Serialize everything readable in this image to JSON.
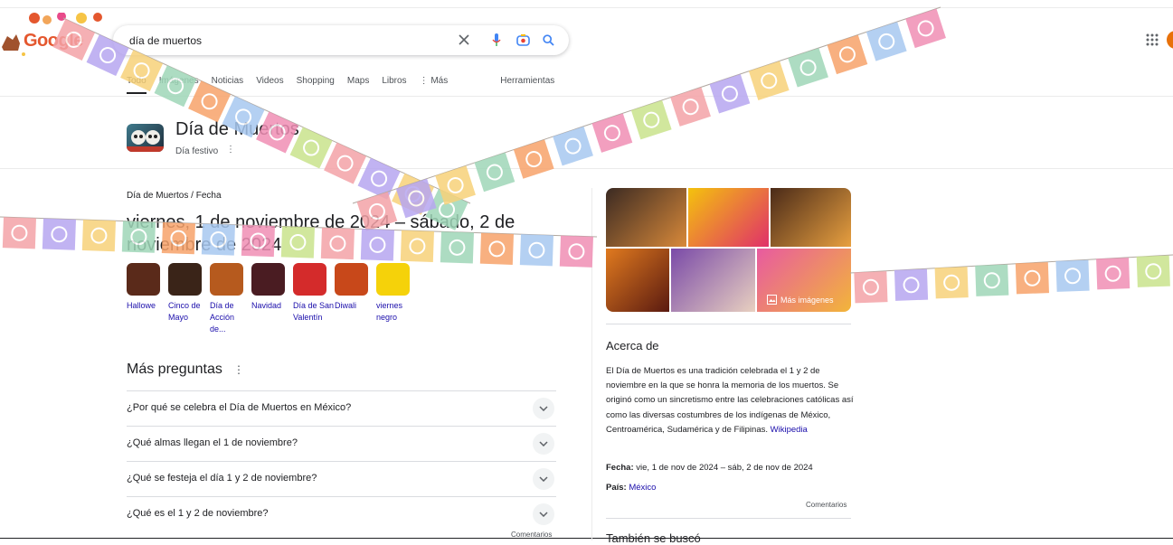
{
  "logo": {
    "text": "Google"
  },
  "search": {
    "value": "día de muertos"
  },
  "tabs": [
    {
      "label": "Todo"
    },
    {
      "label": "Imágenes"
    },
    {
      "label": "Noticias"
    },
    {
      "label": "Videos"
    },
    {
      "label": "Shopping"
    },
    {
      "label": "Maps"
    },
    {
      "label": "Libros"
    },
    {
      "label": "⋮ Más"
    },
    {
      "label": "Herramientas"
    }
  ],
  "entity": {
    "title": "Día de Muertos",
    "subtitle": "Día festivo"
  },
  "answer": {
    "breadcrumb_1": "Día de Muertos",
    "breadcrumb_sep": "/",
    "breadcrumb_2": "Fecha",
    "text": "viernes, 1 de noviembre de 2024 – sábado, 2 de noviembre de 2024"
  },
  "holidays": [
    {
      "label": "Hallowe",
      "color": "#5a2a1a"
    },
    {
      "label": "Cinco de Mayo",
      "color": "#3a2418"
    },
    {
      "label": "Día de Acción de...",
      "color": "#b65a1e"
    },
    {
      "label": "Navidad",
      "color": "#4a1c22"
    },
    {
      "label": "Día de San Valentín",
      "color": "#d42b2b"
    },
    {
      "label": "Diwali",
      "color": "#c8481a"
    },
    {
      "label": "viernes negro",
      "color": "#f5d20a"
    }
  ],
  "paa": {
    "title": "Más preguntas",
    "questions": [
      "¿Por qué se celebra el Día de Muertos en México?",
      "¿Qué almas llegan el 1 de noviembre?",
      "¿Qué se festeja el día 1 y 2 de noviembre?",
      "¿Qué es el 1 y 2 de noviembre?"
    ],
    "feedback": "Comentarios"
  },
  "panel": {
    "more_images": "Más imágenes",
    "about_title": "Acerca de",
    "description": "El Día de Muertos es una tradición celebrada el 1 y 2 de noviembre en la que se honra la memoria de los muertos. Se originó como un sincretismo entre las celebraciones católicas así como las diversas costumbres de los indígenas de México, Centroamérica, Sudamérica y de Filipinas.",
    "source": "Wikipedia",
    "date_label": "Fecha:",
    "date_value": "vie, 1 de nov de 2024 – sáb, 2 de nov de 2024",
    "country_label": "País:",
    "country_value": "México",
    "feedback": "Comentarios",
    "also_searched": "También se buscó"
  },
  "colors": {
    "link": "#1a0dab",
    "accent": "#1a73e8"
  }
}
